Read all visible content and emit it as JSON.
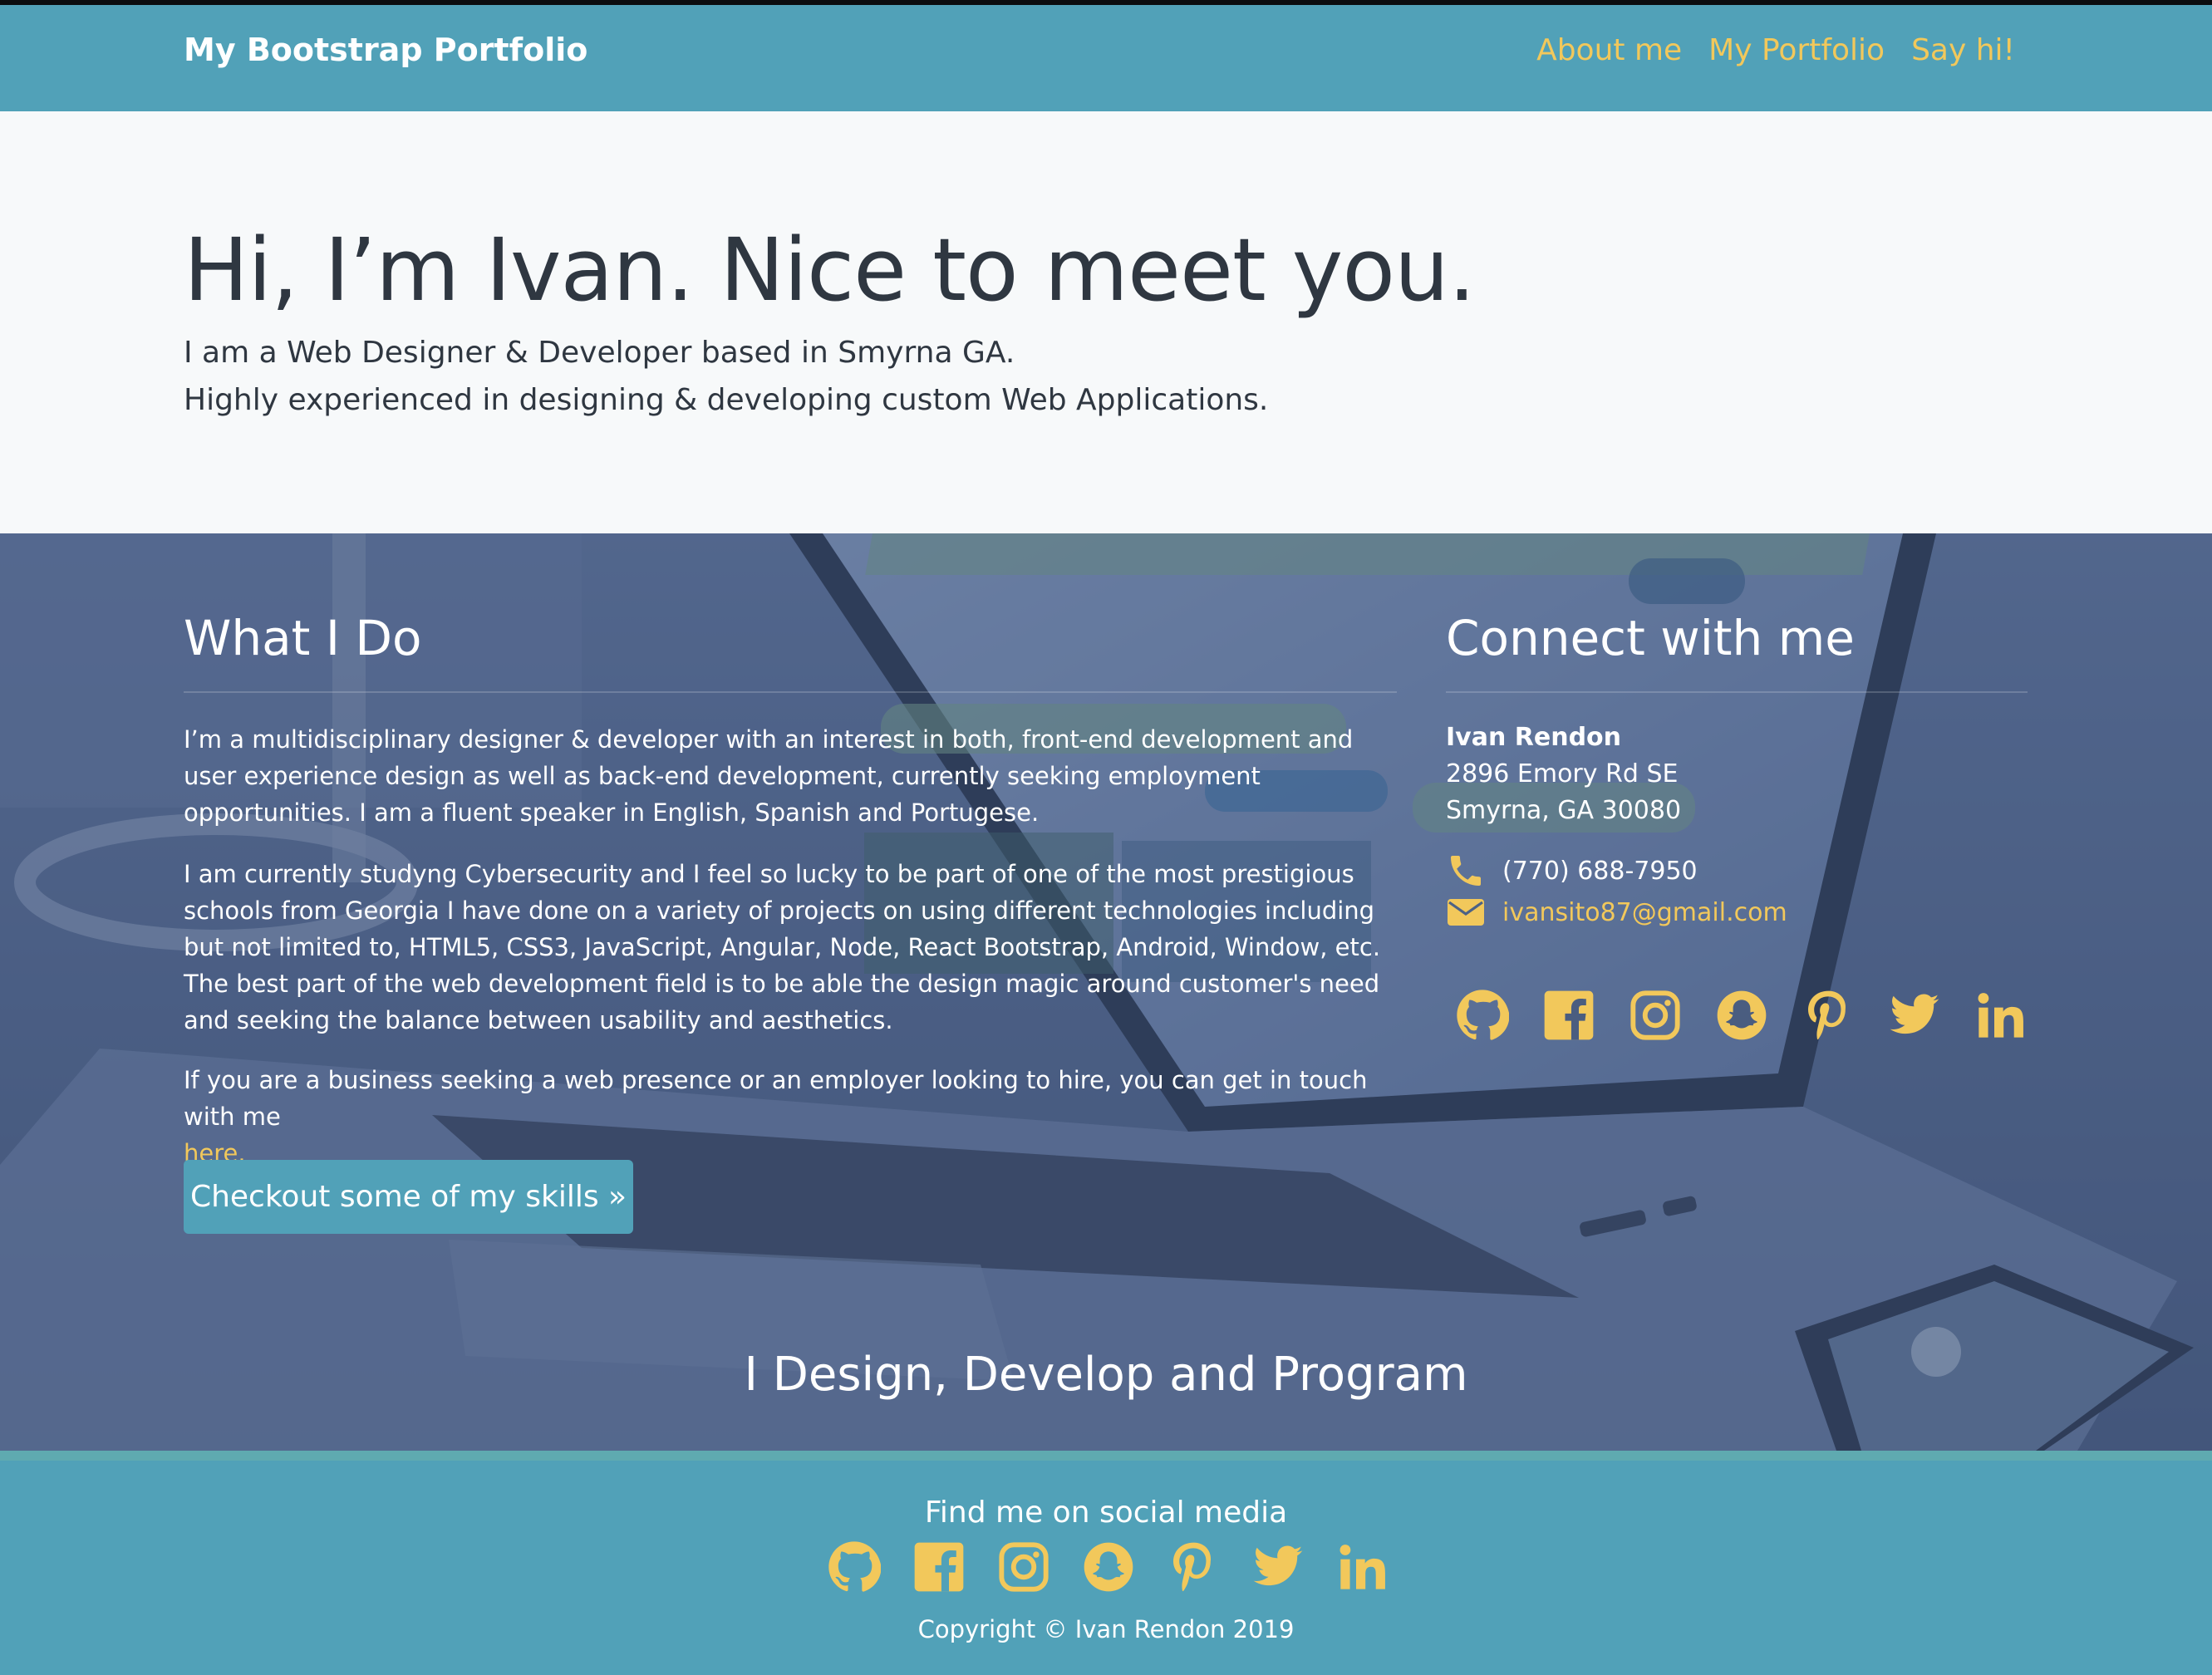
{
  "nav": {
    "brand": "My Bootstrap Portfolio",
    "links": [
      "About me",
      "My Portfolio",
      "Say hi!"
    ]
  },
  "jumbotron": {
    "heading": "Hi, I’m Ivan. Nice to meet you.",
    "lead_line1": "I am a Web Designer & Developer based in Smyrna GA.",
    "lead_line2": "Highly experienced in designing & developing custom Web Applications."
  },
  "what_i_do": {
    "title": "What I Do",
    "p1": "I’m a multidisciplinary designer & developer with an interest in both, front-end development and user experience design as well as back-end development, currently seeking employment opportunities. I am a fluent speaker in English, Spanish and Portugese.",
    "p2": "I am currently studyng Cybersecurity and I feel so lucky to be part of one of the most prestigious schools from Georgia I have done on a variety of projects on using different technologies including but not limited to, HTML5, CSS3, JavaScript, Angular, Node, React Bootstrap, Android, Window, etc. The best part of the web development field is to be able the design magic around customer's need and seeking the balance between usability and aesthetics.",
    "p3": "If you are a business seeking a web presence or an employer looking to hire, you can get in touch with me",
    "p3_link": "here.",
    "button": "Checkout some of my skills »"
  },
  "connect": {
    "title": "Connect with me",
    "name": "Ivan Rendon",
    "address1": "2896 Emory Rd SE",
    "address2": "Smyrna, GA 30080",
    "phone": "(770) 688-7950",
    "email": "ivansito87@gmail.com",
    "social_icons": [
      "github-icon",
      "facebook-icon",
      "instagram-icon",
      "snapchat-icon",
      "pinterest-icon",
      "twitter-icon",
      "linkedin-icon"
    ]
  },
  "tagline": "I Design, Develop and Program",
  "footer": {
    "title": "Find me on social media",
    "copyright": "Copyright © Ivan Rendon 2019"
  },
  "colors": {
    "brand": "#51a1b8",
    "accent": "#f2c85b",
    "text_dark": "#2f3741"
  }
}
